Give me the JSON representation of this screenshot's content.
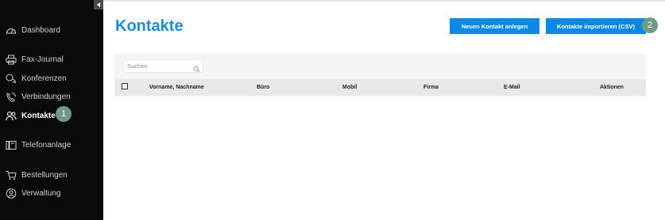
{
  "sidebar": {
    "items": [
      {
        "label": "Dashboard",
        "icon": "dashboard-gauge-icon"
      },
      {
        "label": "Fax-Journal",
        "icon": "fax-printer-icon"
      },
      {
        "label": "Konferenzen",
        "icon": "conference-icon"
      },
      {
        "label": "Verbindungen",
        "icon": "phone-connections-icon"
      },
      {
        "label": "Kontakte",
        "icon": "contacts-people-icon",
        "active": true
      },
      {
        "label": "Telefonanlage",
        "icon": "telephone-system-icon"
      },
      {
        "label": "Bestellungen",
        "icon": "shopping-cart-icon"
      },
      {
        "label": "Verwaltung",
        "icon": "user-admin-icon"
      }
    ]
  },
  "badges": {
    "first": "1",
    "second": "2"
  },
  "page": {
    "title": "Kontakte"
  },
  "actions": {
    "new_contact": "Neuen Kontakt anlegen",
    "import_csv": "Kontakte importieren (CSV)"
  },
  "search": {
    "placeholder": "Suchen"
  },
  "table": {
    "columns": [
      "Vorname, Nachname",
      "Büro",
      "Mobil",
      "Firma",
      "E-Mail",
      "Aktionen"
    ]
  },
  "colors": {
    "accent": "#0a8ae6",
    "title": "#1a8de0",
    "sidebar_bg": "#0a0a0a",
    "badge": "#6f9a86"
  }
}
